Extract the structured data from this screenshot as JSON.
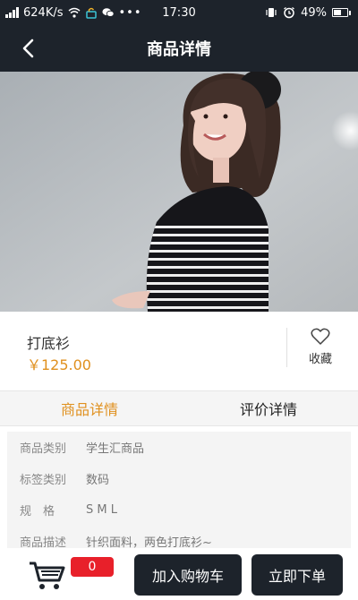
{
  "status_bar": {
    "network_speed": "624K/s",
    "time": "17:30",
    "battery": "49%",
    "battery_level": 0.49,
    "icons": [
      "signal-icon",
      "wifi-icon",
      "lock-icon",
      "wechat-icon",
      "more-icon",
      "vibrate-icon",
      "alarm-icon",
      "battery-icon"
    ]
  },
  "header": {
    "title": "商品详情",
    "back_icon": "chevron-left-icon"
  },
  "product": {
    "name": "打底衫",
    "price": "￥125.00",
    "favorite_label": "收藏",
    "favorite_icon": "heart-outline-icon"
  },
  "tabs": [
    {
      "label": "商品详情",
      "active": true
    },
    {
      "label": "评价详情",
      "active": false
    }
  ],
  "details": [
    {
      "label": "商品类别",
      "value": "学生汇商品"
    },
    {
      "label": "标签类别",
      "value": "数码"
    },
    {
      "label": "规　格",
      "value": "S M L"
    },
    {
      "label": "商品描述",
      "value": "针织面料，两色打底衫~"
    }
  ],
  "bottom_bar": {
    "cart_icon": "shopping-cart-icon",
    "cart_count": "0",
    "add_to_cart_label": "加入购物车",
    "buy_now_label": "立即下单"
  },
  "colors": {
    "header_bg": "#1d232b",
    "accent": "#e0901e",
    "badge": "#e8202a"
  }
}
